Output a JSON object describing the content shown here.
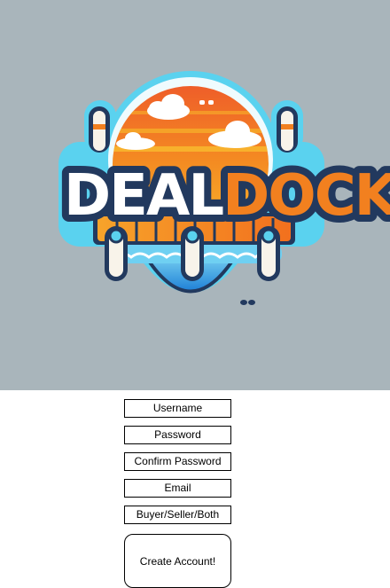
{
  "logo": {
    "word_part1": "DEAL",
    "word_part2": "DOCK",
    "icon": "dealdock-logo-icon"
  },
  "form": {
    "username_placeholder": "Username",
    "password_placeholder": "Password",
    "confirm_password_placeholder": "Confirm Password",
    "email_placeholder": "Email",
    "role_placeholder": "Buyer/Seller/Both",
    "create_button_label": "Create Account!"
  },
  "colors": {
    "hero_background": "#a9b5bb",
    "logo_outline": "#5ad2ef",
    "logo_navy": "#22395e",
    "logo_orange": "#f2801f",
    "logo_sun": "#f7a51d",
    "logo_water": "#2b9be3"
  }
}
